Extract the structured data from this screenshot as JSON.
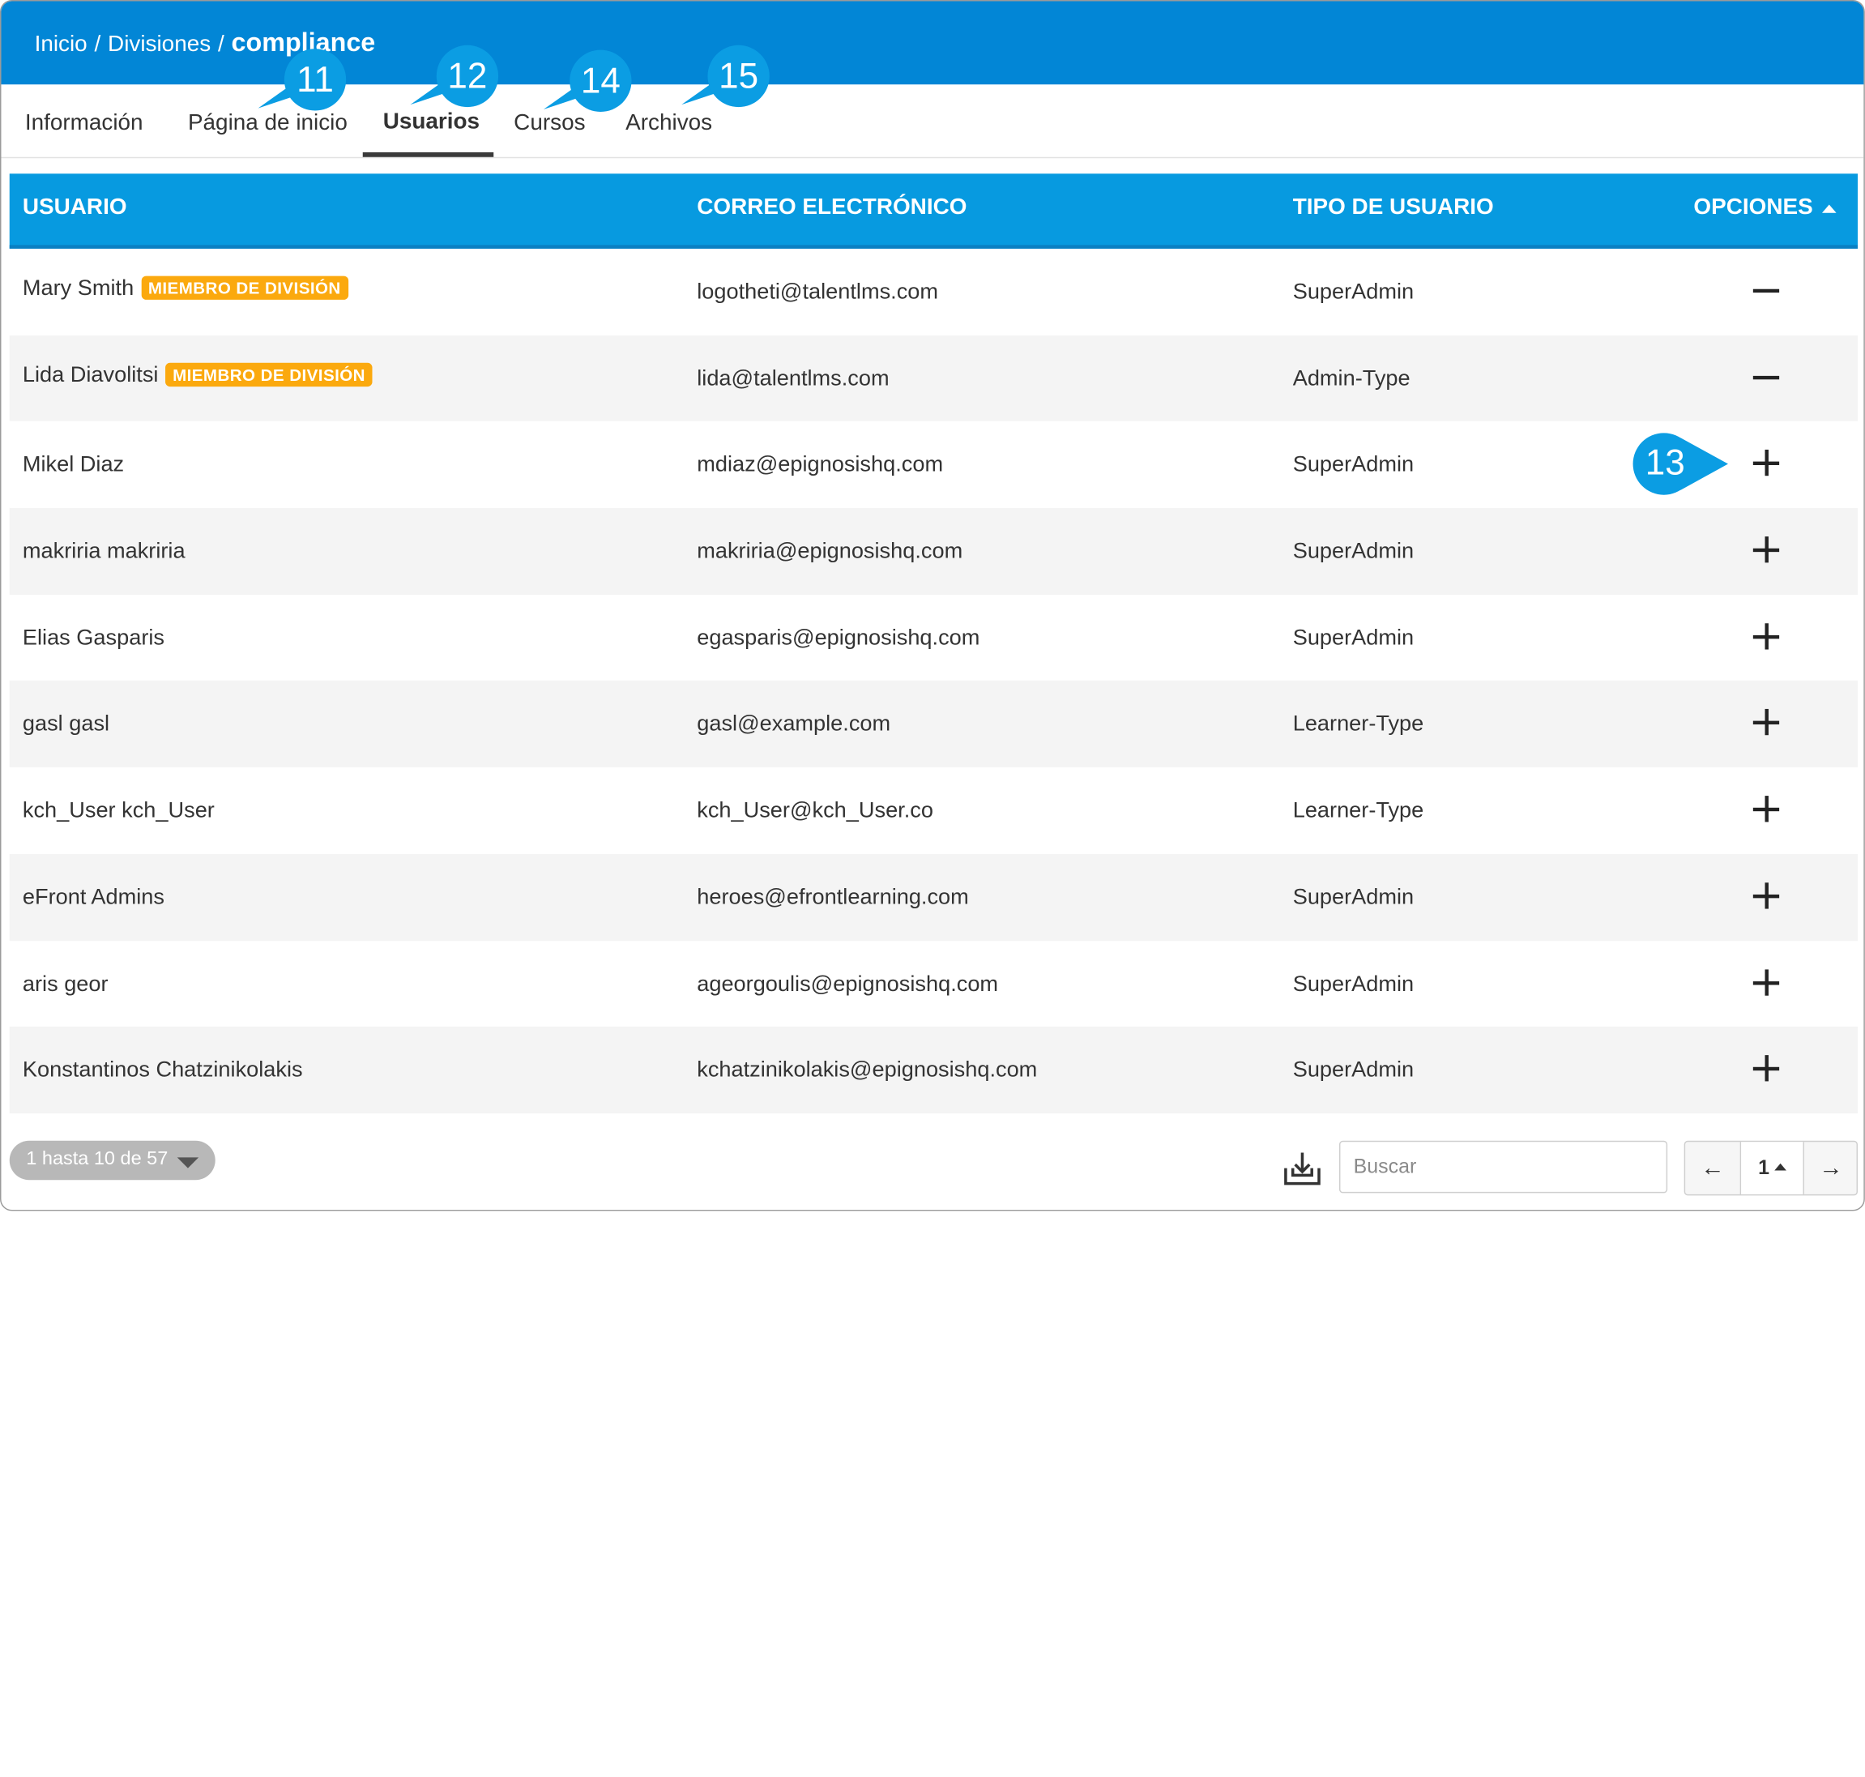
{
  "breadcrumb": {
    "home": "Inicio",
    "sep1": "/",
    "section": "Divisiones",
    "sep2": "/",
    "current": "compliance"
  },
  "tabs": [
    {
      "label": "Información"
    },
    {
      "label": "Página de inicio"
    },
    {
      "label": "Usuarios",
      "active": true
    },
    {
      "label": "Cursos"
    },
    {
      "label": "Archivos"
    }
  ],
  "table": {
    "headers": {
      "user": "USUARIO",
      "email": "CORREO ELECTRÓNICO",
      "type": "TIPO DE USUARIO",
      "options": "OPCIONES"
    },
    "sort_icon": "caret-up-icon",
    "rows": [
      {
        "name": "Mary Smith",
        "badge": "MIEMBRO DE DIVISIÓN",
        "email": "logotheti@talentlms.com",
        "type": "SuperAdmin",
        "option": "minus-icon"
      },
      {
        "name": "Lida Diavolitsi",
        "badge": "MIEMBRO DE DIVISIÓN",
        "email": "lida@talentlms.com",
        "type": "Admin-Type",
        "option": "minus-icon"
      },
      {
        "name": "Mikel Diaz",
        "email": "mdiaz@epignosishq.com",
        "type": "SuperAdmin",
        "option": "plus-icon"
      },
      {
        "name": "makriria makriria",
        "email": "makriria@epignosishq.com",
        "type": "SuperAdmin",
        "option": "plus-icon"
      },
      {
        "name": "Elias Gasparis",
        "email": "egasparis@epignosishq.com",
        "type": "SuperAdmin",
        "option": "plus-icon"
      },
      {
        "name": "gasl gasl",
        "email": "gasl@example.com",
        "type": "Learner-Type",
        "option": "plus-icon"
      },
      {
        "name": "kch_User kch_User",
        "email": "kch_User@kch_User.co",
        "type": "Learner-Type",
        "option": "plus-icon"
      },
      {
        "name": "eFront Admins",
        "email": "heroes@efrontlearning.com",
        "type": "SuperAdmin",
        "option": "plus-icon"
      },
      {
        "name": "aris geor",
        "email": "ageorgoulis@epignosishq.com",
        "type": "SuperAdmin",
        "option": "plus-icon"
      },
      {
        "name": "Konstantinos Chatzinikolakis",
        "email": "kchatzinikolakis@epignosishq.com",
        "type": "SuperAdmin",
        "option": "plus-icon"
      }
    ]
  },
  "footer": {
    "range_label": "1 hasta 10 de 57",
    "export_icon": "download-tray-icon",
    "search_placeholder": "Buscar",
    "search_value": "",
    "pager": {
      "prev": "←",
      "current": "1",
      "next": "→"
    }
  },
  "callouts": [
    {
      "label": "11"
    },
    {
      "label": "12"
    },
    {
      "label": "14"
    },
    {
      "label": "15"
    },
    {
      "label": "13"
    }
  ],
  "colors": {
    "topbar": "#0286d6",
    "table_header": "#079ae0",
    "badge": "#fba90e",
    "callout": "#0b9de3"
  }
}
